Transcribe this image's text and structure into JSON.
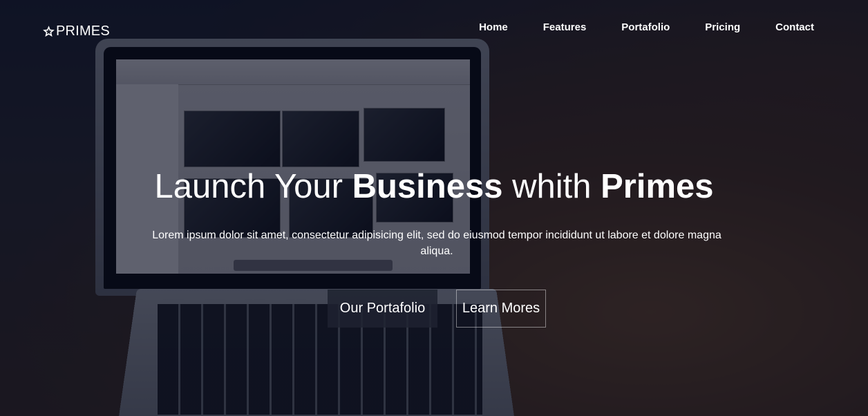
{
  "brand": {
    "icon": "star-icon",
    "name": "PRIMES"
  },
  "nav": {
    "items": [
      {
        "label": "Home"
      },
      {
        "label": "Features"
      },
      {
        "label": "Portafolio"
      },
      {
        "label": "Pricing"
      },
      {
        "label": "Contact"
      }
    ]
  },
  "hero": {
    "headline": {
      "part1": "Launch Your ",
      "bold1": "Business",
      "part2": " whith ",
      "bold2": "Primes"
    },
    "subtitle": "Lorem ipsum dolor sit amet, consectetur adipisicing elit, sed do eiusmod tempor incididunt ut labore et dolore magna aliqua.",
    "primary_button": "Our Portafolio",
    "secondary_button": "Learn Mores"
  },
  "colors": {
    "text": "#ffffff",
    "overlay": "#080c1e",
    "primary_button_bg": "#1e2230"
  }
}
